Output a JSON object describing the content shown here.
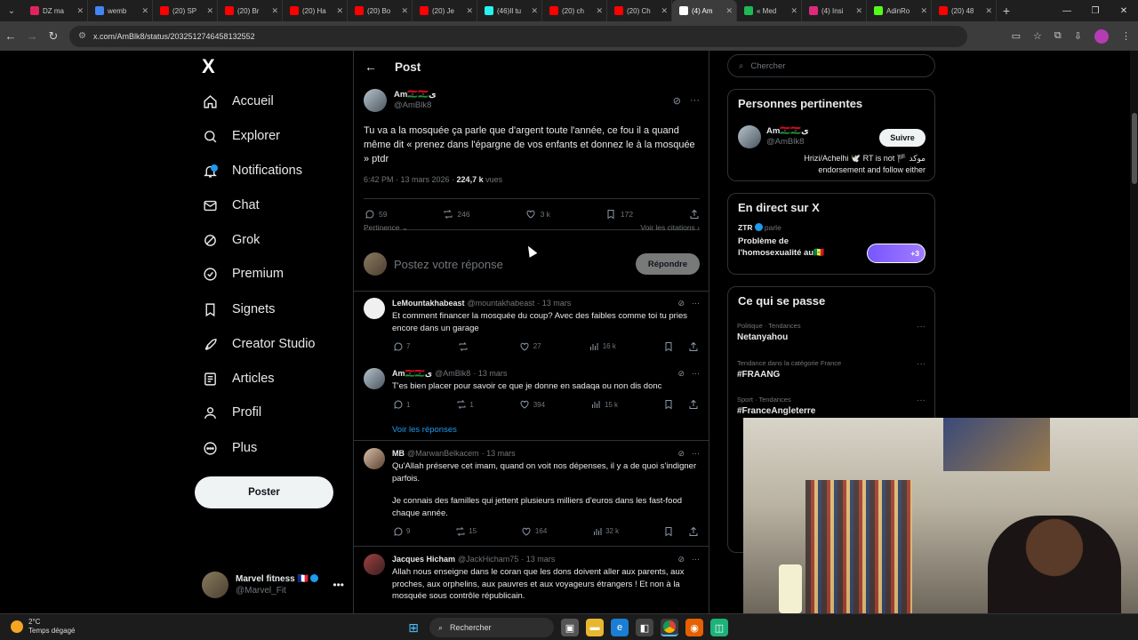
{
  "browser": {
    "tabs": [
      {
        "title": "DZ ma",
        "favicon_color": "#e0245e",
        "active": false
      },
      {
        "title": "wemb",
        "favicon_color": "#4285f4",
        "active": false
      },
      {
        "title": "(20) SP",
        "favicon_color": "#ff0000",
        "active": false
      },
      {
        "title": "(20) Br",
        "favicon_color": "#ff0000",
        "active": false
      },
      {
        "title": "(20) Ha",
        "favicon_color": "#ff0000",
        "active": false
      },
      {
        "title": "(20) Bo",
        "favicon_color": "#ff0000",
        "active": false
      },
      {
        "title": "(20) Je",
        "favicon_color": "#ff0000",
        "active": false
      },
      {
        "title": "(46)Il tu",
        "favicon_color": "#25f4ee",
        "active": false
      },
      {
        "title": "(20) ch",
        "favicon_color": "#ff0000",
        "active": false
      },
      {
        "title": "(20) Ch",
        "favicon_color": "#ff0000",
        "active": false
      },
      {
        "title": "(4) Am",
        "favicon_color": "#ffffff",
        "active": true
      },
      {
        "title": "« Med",
        "favicon_color": "#1db954",
        "active": false
      },
      {
        "title": "(4) Insi",
        "favicon_color": "#dd2a7b",
        "active": false
      },
      {
        "title": "AdinRo",
        "favicon_color": "#53fc18",
        "active": false
      },
      {
        "title": "(20) 48",
        "favicon_color": "#ff0000",
        "active": false
      }
    ],
    "url": "x.com/AmBlk8/status/2032512746458132552"
  },
  "sidebar": {
    "logo": "X",
    "items": [
      {
        "label": "Accueil",
        "icon": "home-icon"
      },
      {
        "label": "Explorer",
        "icon": "search-icon"
      },
      {
        "label": "Notifications",
        "icon": "bell-icon"
      },
      {
        "label": "Chat",
        "icon": "mail-icon"
      },
      {
        "label": "Grok",
        "icon": "grok-icon"
      },
      {
        "label": "Premium",
        "icon": "premium-icon"
      },
      {
        "label": "Signets",
        "icon": "bookmark-icon"
      },
      {
        "label": "Creator Studio",
        "icon": "rocket-icon"
      },
      {
        "label": "Articles",
        "icon": "article-icon"
      },
      {
        "label": "Profil",
        "icon": "user-icon"
      },
      {
        "label": "Plus",
        "icon": "more-circle-icon"
      }
    ],
    "post_button": "Poster",
    "account": {
      "name": "Marvel fitness 🇫🇷",
      "handle": "@Marvel_Fit"
    }
  },
  "post": {
    "header": "Post",
    "author": {
      "name": "Am🇱🇾🇱🇾ی",
      "handle": "@AmBlk8"
    },
    "text": "Tu va a la mosquée ça parle que d'argent toute l'année, ce fou il a quand même dit « prenez dans l'épargne de vos enfants et donnez le à la mosquée » ptdr",
    "time": "6:42 PM · 13 mars 2026 · ",
    "views_count": "224,7 k",
    "views_label": " vues",
    "stats": {
      "replies": "59",
      "reposts": "246",
      "likes": "3 k",
      "bookmarks": "172"
    },
    "sort_label": "Pertinence ⌄",
    "quotes_link": "Voir les citations ›",
    "reply_placeholder": "Postez votre réponse",
    "reply_button": "Répondre"
  },
  "replies": [
    {
      "name": "LeMountakhabeast",
      "handle": "@mountakhabeast",
      "date": "· 13 mars",
      "text": [
        "Et comment financer la mosquée du coup? Avec des faibles comme toi tu pries encore dans un garage"
      ],
      "replies": "7",
      "reposts": "",
      "likes": "27",
      "views": "16 k"
    },
    {
      "name": "Am🇱🇾🇱🇾ی",
      "handle": "@AmBlk8",
      "date": "· 13 mars",
      "text": [
        "T'es bien placer pour savoir ce que je donne en sadaqa ou non dis donc"
      ],
      "replies": "1",
      "reposts": "1",
      "likes": "394",
      "views": "15 k",
      "show_replies": "Voir les réponses"
    },
    {
      "name": "MB",
      "handle": "@MarwanBelkacem",
      "date": "· 13 mars",
      "text": [
        "Qu'Allah préserve cet imam, quand on voit nos dépenses, il y a de quoi s'indigner parfois.",
        "Je connais des familles qui jettent plusieurs milliers d'euros dans les fast-food chaque année."
      ],
      "replies": "9",
      "reposts": "15",
      "likes": "164",
      "views": "32 k"
    },
    {
      "name": "Jacques Hicham",
      "handle": "@JackHicham75",
      "date": "· 13 mars",
      "text": [
        "Allah nous enseigne dans le coran que les dons doivent aller aux parents, aux proches, aux orphelins, aux pauvres et aux voyageurs étrangers ! Et non à la mosquée sous contrôle républicain."
      ]
    }
  ],
  "right": {
    "search_placeholder": "Chercher",
    "relevant": {
      "title": "Personnes pertinentes",
      "name": "Am🇱🇾🇱🇾ی",
      "handle": "@AmBlk8",
      "follow": "Suivre",
      "bio": "Hrizi/Achelhi 🕊️ RT is not 🏴 موكد endorsement and follow either"
    },
    "live": {
      "title": "En direct sur X",
      "host": "ZTR",
      "host_suffix": " parle",
      "topic": "Problème de l'homosexualité au🇸🇳",
      "badge": "+3"
    },
    "trends": {
      "title": "Ce qui se passe",
      "items": [
        {
          "category": "Politique · Tendances",
          "name": "Netanyahou"
        },
        {
          "category": "Tendance dans la catégorie France",
          "name": "#FRAANG"
        },
        {
          "category": "Sport · Tendances",
          "name": "#FranceAngleterre"
        }
      ]
    }
  },
  "taskbar": {
    "temperature": "2°C",
    "weather": "Temps dégagé",
    "search": "Rechercher"
  }
}
